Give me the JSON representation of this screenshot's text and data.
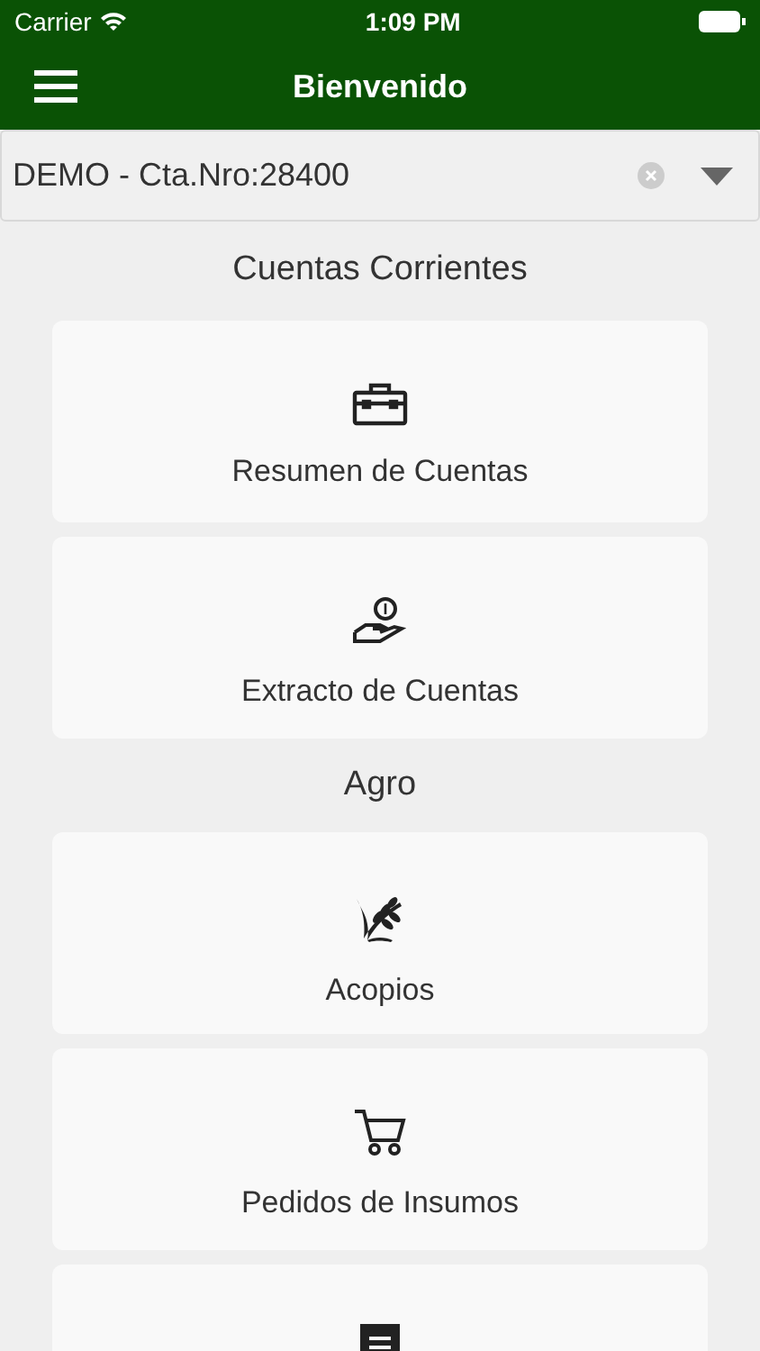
{
  "status_bar": {
    "carrier": "Carrier",
    "time": "1:09 PM"
  },
  "header": {
    "title": "Bienvenido"
  },
  "account_select": {
    "value": "DEMO - Cta.Nro:28400"
  },
  "sections": [
    {
      "title": "Cuentas Corrientes",
      "items": [
        {
          "kind": "briefcase",
          "label": "Resumen de Cuentas"
        },
        {
          "kind": "coin",
          "label": "Extracto de Cuentas"
        }
      ]
    },
    {
      "title": "Agro",
      "items": [
        {
          "kind": "wheat",
          "label": "Acopios"
        },
        {
          "kind": "cart",
          "label": "Pedidos de Insumos"
        },
        {
          "kind": "receipt"
        }
      ]
    }
  ]
}
